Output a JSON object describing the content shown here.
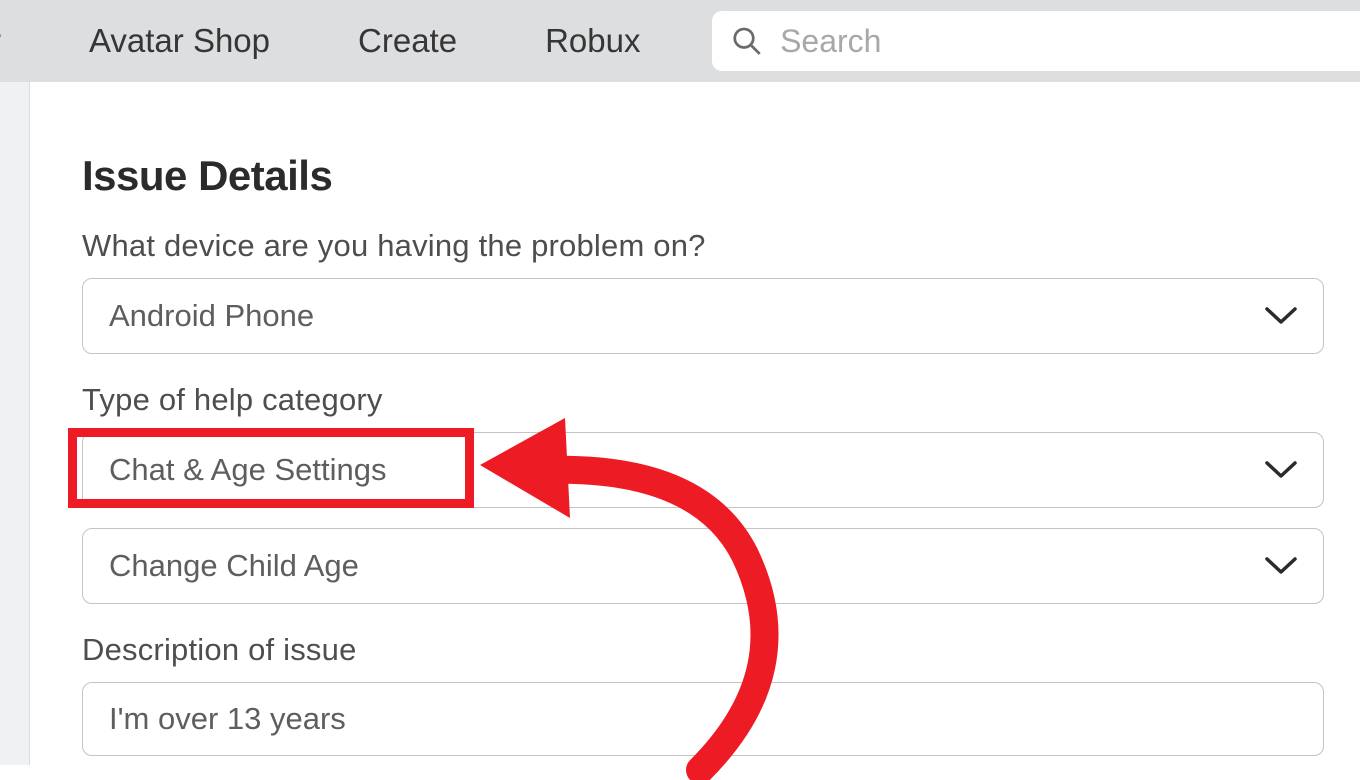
{
  "nav": {
    "truncated_item": "r",
    "items": [
      "Avatar Shop",
      "Create",
      "Robux"
    ],
    "search_placeholder": "Search"
  },
  "form": {
    "section_title": "Issue Details",
    "device_label": "What device are you having the problem on?",
    "device_value": "Android Phone",
    "category_label": "Type of help category",
    "category_value": "Chat & Age Settings",
    "subcategory_value": "Change Child Age",
    "description_label": "Description of issue",
    "description_value": "I'm over 13 years"
  },
  "annotation": {
    "highlight_color": "#ed1c24"
  }
}
